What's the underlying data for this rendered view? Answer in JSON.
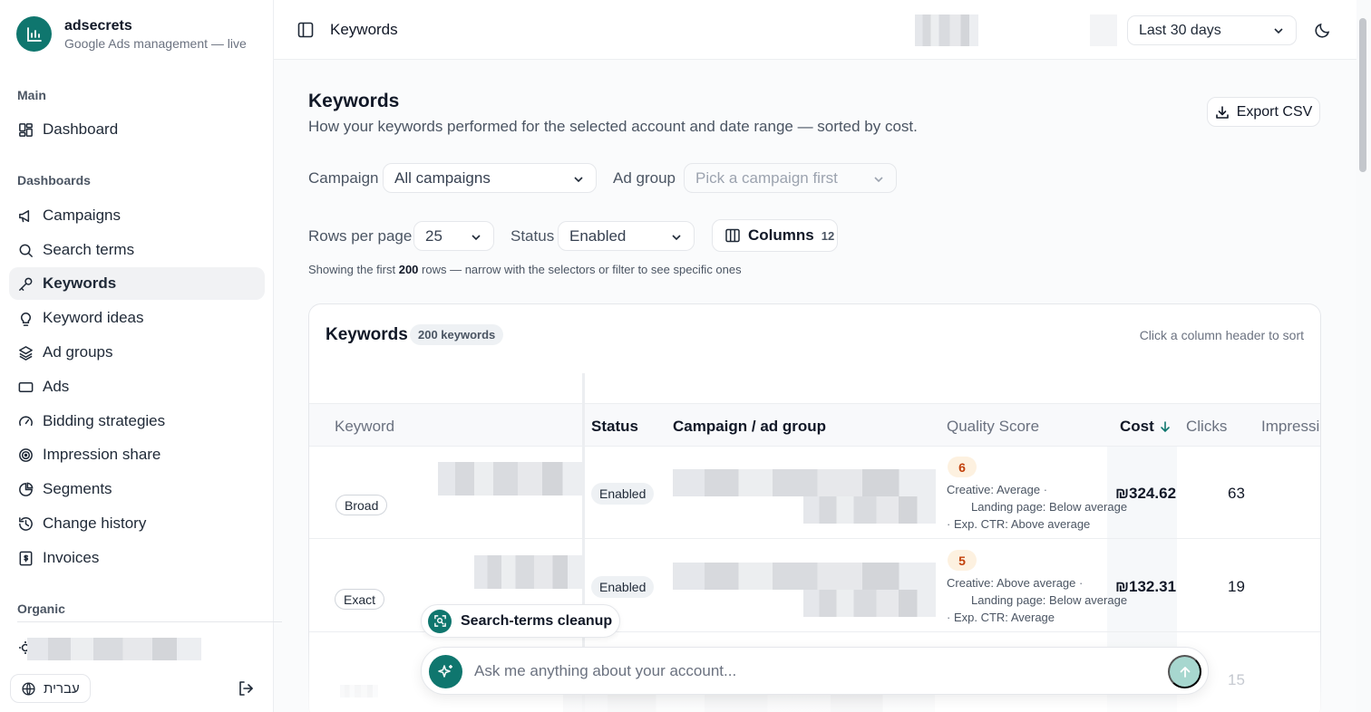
{
  "brand": {
    "name": "adsecrets",
    "subtitle": "Google Ads management — live"
  },
  "sidebar": {
    "sections": {
      "main": "Main",
      "dashboards": "Dashboards",
      "organic": "Organic"
    },
    "items": [
      {
        "label": "Dashboard",
        "icon": "grid-icon"
      },
      {
        "label": "Campaigns",
        "icon": "megaphone-icon"
      },
      {
        "label": "Search terms",
        "icon": "search-icon"
      },
      {
        "label": "Keywords",
        "icon": "key-icon",
        "active": true
      },
      {
        "label": "Keyword ideas",
        "icon": "lightbulb-icon"
      },
      {
        "label": "Ad groups",
        "icon": "layers-icon"
      },
      {
        "label": "Ads",
        "icon": "rectangle-icon"
      },
      {
        "label": "Bidding strategies",
        "icon": "gauge-icon"
      },
      {
        "label": "Impression share",
        "icon": "target-icon"
      },
      {
        "label": "Segments",
        "icon": "pie-icon"
      },
      {
        "label": "Change history",
        "icon": "history-icon"
      },
      {
        "label": "Invoices",
        "icon": "invoice-icon"
      }
    ],
    "language_label": "עברית"
  },
  "topbar": {
    "title": "Keywords",
    "date_range": "Last 30 days"
  },
  "page": {
    "title": "Keywords",
    "subtitle": "How your keywords performed for the selected account and date range — sorted by cost.",
    "export_label": "Export CSV"
  },
  "filters": {
    "campaign_label": "Campaign",
    "campaign_value": "All campaigns",
    "adgroup_label": "Ad group",
    "adgroup_placeholder": "Pick a campaign first",
    "rows_label": "Rows per page",
    "rows_value": "25",
    "status_label": "Status",
    "status_value": "Enabled",
    "columns_label": "Columns",
    "columns_count": "12",
    "showing_prefix": "Showing the first ",
    "showing_count": "200",
    "showing_suffix": " rows — narrow with the selectors or filter to see specific ones"
  },
  "table": {
    "title": "Keywords",
    "count_badge": "200 keywords",
    "sort_hint": "Click a column header to sort",
    "columns": [
      "Keyword",
      "Status",
      "Campaign / ad group",
      "Quality Score",
      "Cost",
      "Clicks",
      "Impressio"
    ],
    "rows": [
      {
        "match": "Broad",
        "status": "Enabled",
        "qs": "6",
        "creative_label": "Creative:",
        "creative": "Average",
        "landing_label": "Landing page:",
        "landing": "Below average",
        "ctr_label": "Exp. CTR:",
        "ctr": "Above average",
        "cost": "₪324.62",
        "clicks": "63"
      },
      {
        "match": "Exact",
        "status": "Enabled",
        "qs": "5",
        "creative_label": "Creative:",
        "creative": "Above average",
        "landing_label": "Landing page:",
        "landing": "Below average",
        "ctr_label": "Exp. CTR:",
        "ctr": "Average",
        "cost": "₪132.31",
        "clicks": "19"
      }
    ],
    "third_row_clicks": "15"
  },
  "assistant": {
    "chip_label": "Search-terms cleanup",
    "placeholder": "Ask me anything about your account..."
  },
  "colors": {
    "accent": "#0f766e",
    "qs_badge_bg": "#fdf1e0",
    "qs_badge_text": "#c2410c"
  }
}
